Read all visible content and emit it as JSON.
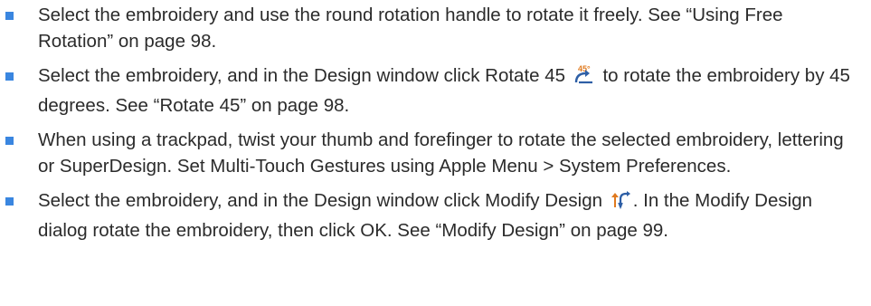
{
  "bullet_color": "#3a86e0",
  "items": [
    {
      "before": "Select the embroidery and use the round rotation handle to rotate it freely. See “Using Free Rotation” on page 98.",
      "icon": "",
      "after": ""
    },
    {
      "before": "Select the embroidery, and in the Design window click Rotate 45",
      "icon": "rotate-45-icon",
      "after": "to rotate the embroidery by 45 degrees. See “Rotate 45” on page 98."
    },
    {
      "before": "When using a trackpad, twist your thumb and forefinger to rotate the selected embroidery, lettering or SuperDesign. Set Multi-Touch Gestures using Apple Menu > System Preferences.",
      "icon": "",
      "after": ""
    },
    {
      "before": "Select the embroidery, and in the Design window click Modify Design",
      "icon": "modify-design-icon",
      "after": ". In the Modify Design dialog rotate the embroidery, then click OK. See “Modify Design” on page 99."
    }
  ]
}
